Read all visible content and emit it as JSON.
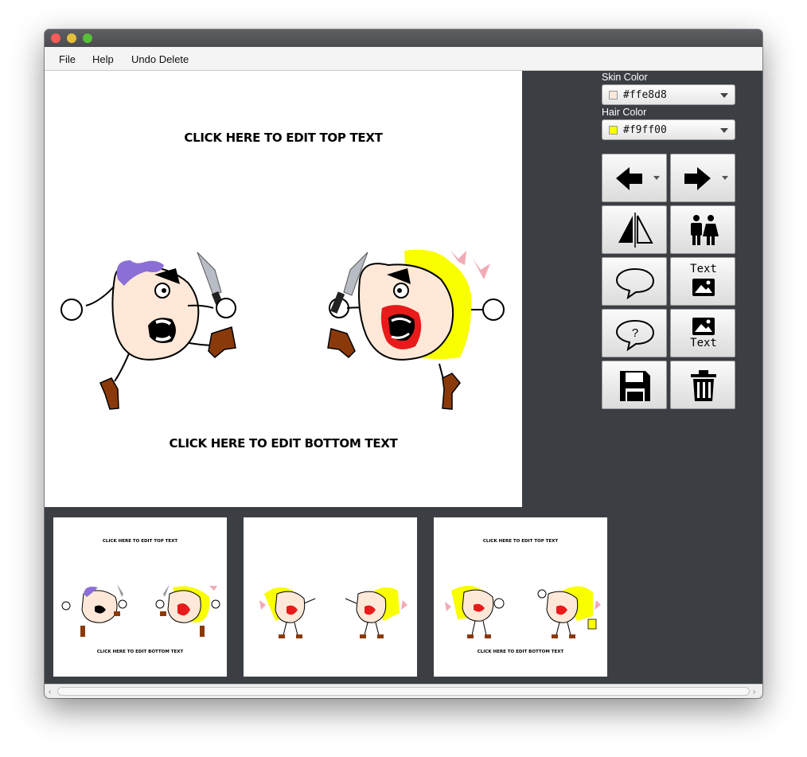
{
  "menu": {
    "items": [
      "File",
      "Help",
      "Undo Delete"
    ]
  },
  "editor": {
    "top_text": "CLICK HERE TO EDIT TOP TEXT",
    "bottom_text": "CLICK HERE TO EDIT BOTTOM TEXT"
  },
  "controls": {
    "skin_label": "Skin Color",
    "skin_value": "#ffe8d8",
    "skin_color": "#ffe8d8",
    "hair_label": "Hair Color",
    "hair_value": "#f9ff00",
    "hair_color": "#f9ff00"
  },
  "toolbar": {
    "text_word": "Text",
    "question_mark": "?"
  },
  "thumbnails": [
    {
      "top_text": "CLICK HERE TO EDIT TOP TEXT",
      "bottom_text": "CLICK HERE TO EDIT BOTTOM TEXT"
    },
    {
      "top_text": "",
      "bottom_text": ""
    },
    {
      "top_text": "CLICK HERE TO EDIT TOP TEXT",
      "bottom_text": "CLICK HERE TO EDIT BOTTOM TEXT"
    }
  ],
  "colors": {
    "panel_bg": "#3b3e43",
    "purple_hair": "#8b6fd6",
    "lips_red": "#e81a1a",
    "boot_brown": "#8a3a0a",
    "bow_pink": "#f2aab4"
  },
  "scrollbar": {
    "left_arrow": "‹",
    "right_arrow": "›"
  }
}
